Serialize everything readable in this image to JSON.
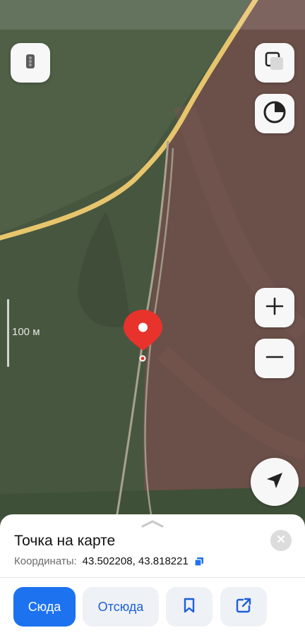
{
  "map": {
    "scale_label": "100 м",
    "colors": {
      "field_green": "#4a5a45",
      "field_brown": "#6e4f48",
      "road": "#e9c46a",
      "pin": "#e8322c"
    }
  },
  "controls": {
    "traffic_icon": "traffic-light-icon",
    "layers_icon": "layers-icon",
    "compass_icon": "compass-icon",
    "zoom_in_icon": "plus-icon",
    "zoom_out_icon": "minus-icon",
    "locate_icon": "navigation-arrow-icon"
  },
  "sheet": {
    "title": "Точка на карте",
    "coords_label": "Координаты:",
    "coords_value": "43.502208, 43.818221",
    "buttons": {
      "here": "Сюда",
      "from": "Отсюда"
    },
    "accent_color": "#1d72f0"
  }
}
